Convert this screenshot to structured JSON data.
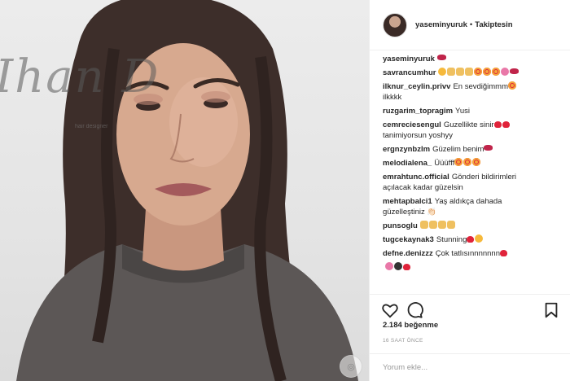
{
  "header": {
    "username": "yaseminyuruk",
    "separator": "•",
    "follow_label": "Takiptesin"
  },
  "photo": {
    "wall_sign": "Ihan D",
    "wall_sub": "hair designer"
  },
  "comments": [
    {
      "user": "yaseminyuruk",
      "text": "",
      "emojis": [
        "kiss"
      ]
    },
    {
      "user": "savrancumhur",
      "text": "",
      "emojis": [
        "smile",
        "hand",
        "hand",
        "hand",
        "heart-eyes",
        "heart-eyes",
        "heart-eyes",
        "pink",
        "kiss"
      ]
    },
    {
      "user": "ilknur_ceylin.privv",
      "text": "En sevdiğimmm",
      "text2": "ilkkkk",
      "emojis": [
        "heart-eyes"
      ]
    },
    {
      "user": "ruzgarim_topragim",
      "text": "Yusi",
      "emojis": []
    },
    {
      "user": "cemreciesengul",
      "text": "Guzellikte sinir",
      "text2": "tanimiyorsun yoshyy",
      "emojis": [
        "heart",
        "heart"
      ]
    },
    {
      "user": "ergnzynbzlm",
      "text": "Güzelim benim",
      "emojis": [
        "kiss"
      ]
    },
    {
      "user": "melodialena_",
      "text": "Üüüfff",
      "emojis": [
        "heart-eyes",
        "heart-eyes",
        "heart-eyes"
      ]
    },
    {
      "user": "emrahtunc.official",
      "text": "Gönderi bildirimleri",
      "text2": "açılacak kadar güzelsin",
      "emojis": []
    },
    {
      "user": "mehtapbalci1",
      "text": "Yaş aldıkça dahada",
      "text2": "güzelleştiniz 👏🏻",
      "emojis": []
    },
    {
      "user": "punsoglu",
      "text": "",
      "emojis": [
        "hand",
        "hand",
        "hand",
        "hand"
      ]
    },
    {
      "user": "tugcekaynak3",
      "text": "Stunning",
      "emojis": [
        "heart",
        "smile"
      ]
    },
    {
      "user": "defne.denizzz",
      "text": "Çok tatlısınnnnnnn",
      "emojis": [
        "heart"
      ]
    },
    {
      "user": "",
      "text": "",
      "emojis": [
        "pink",
        "dark",
        "heart"
      ]
    }
  ],
  "actions": {
    "like_icon": "heart-outline-icon",
    "comment_icon": "comment-bubble-icon",
    "save_icon": "bookmark-icon"
  },
  "likes": "2.184 beğenme",
  "timestamp": "16 SAAT ÖNCE",
  "add_comment": {
    "placeholder": "Yorum ekle..."
  },
  "colors": {
    "text": "#262626",
    "muted": "#999999",
    "border": "#efefef"
  }
}
